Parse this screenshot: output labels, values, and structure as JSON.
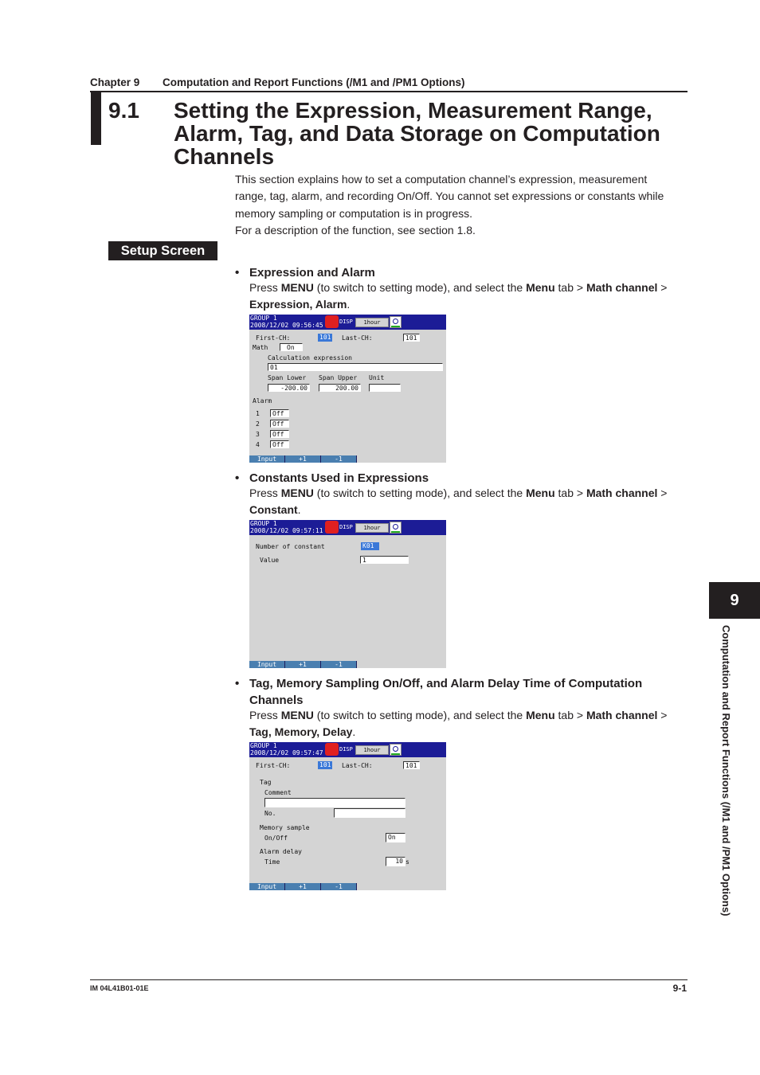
{
  "header": {
    "chapter": "Chapter 9",
    "chapter_title": "Computation and Report Functions (/M1 and /PM1 Options)"
  },
  "section": {
    "number": "9.1",
    "title": "Setting the Expression, Measurement Range, Alarm, Tag, and Data Storage on Computation Channels",
    "intro": [
      "This section explains how to set a computation channel’s expression, measurement range, tag, alarm, and recording On/Off. You cannot set expressions or constants while memory sampling or computation is in progress.",
      "For a description of the function, see section 1.8."
    ]
  },
  "setup_label": "Setup Screen",
  "bullets": [
    {
      "title": "Expression and Alarm",
      "p1": "Press ",
      "menu": "MENU",
      "p2": " (to switch to setting mode), and select the ",
      "menu_tab": "Menu",
      "p3": " tab > ",
      "math": "Math channel",
      "p4": " > ",
      "target": "Expression, Alarm",
      "end": "."
    },
    {
      "title": "Constants Used in Expressions",
      "p1": "Press ",
      "menu": "MENU",
      "p2": " (to switch to setting mode), and select the ",
      "menu_tab": "Menu",
      "p3": " tab > ",
      "math": "Math channel",
      "p4": " > ",
      "target": "Constant",
      "end": "."
    },
    {
      "title": "Tag, Memory Sampling On/Off, and Alarm Delay Time of Computation Channels",
      "p1": "Press ",
      "menu": "MENU",
      "p2": " (to switch to setting mode), and select the ",
      "menu_tab": "Menu",
      "p3": " tab > ",
      "math": "Math channel",
      "p4": " > ",
      "target": "Tag, Memory, Delay",
      "end": "."
    }
  ],
  "screens": {
    "common": {
      "group": "GROUP 1",
      "disp": "DISP",
      "hour": "1hour",
      "keys": [
        "Input",
        "+1",
        "-1"
      ]
    },
    "s1": {
      "time": "2008/12/02 09:56:45",
      "first": "First-CH:",
      "first_val": "101",
      "last": "Last-CH:",
      "last_val": "101",
      "math": "Math",
      "math_val": "On",
      "calc": "Calculation expression",
      "calc_val": "01",
      "span_lower": "Span Lower",
      "span_upper": "Span Upper",
      "unit": "Unit",
      "lower_val": "-200.00",
      "upper_val": "200.00",
      "unit_val": "",
      "alarm": "Alarm",
      "alarms": [
        {
          "n": "1",
          "v": "Off"
        },
        {
          "n": "2",
          "v": "Off"
        },
        {
          "n": "3",
          "v": "Off"
        },
        {
          "n": "4",
          "v": "Off"
        }
      ]
    },
    "s2": {
      "time": "2008/12/02 09:57:11",
      "num": "Number of constant",
      "num_val": "K01",
      "value": "Value",
      "value_val": "1"
    },
    "s3": {
      "time": "2008/12/02 09:57:47",
      "first": "First-CH:",
      "first_val": "101",
      "last": "Last-CH:",
      "last_val": "101",
      "tag": "Tag",
      "comment": "Comment",
      "no": "No.",
      "mem": "Memory sample",
      "onoff": "On/Off",
      "onoff_val": "On",
      "delay": "Alarm delay",
      "time_lbl": "Time",
      "time_val": "10",
      "time_unit": "s"
    }
  },
  "side_tab": {
    "number": "9",
    "text": "Computation and Report Functions (/M1 and /PM1 Options)"
  },
  "footer": {
    "doc_id": "IM 04L41B01-01E",
    "page": "9-1"
  }
}
